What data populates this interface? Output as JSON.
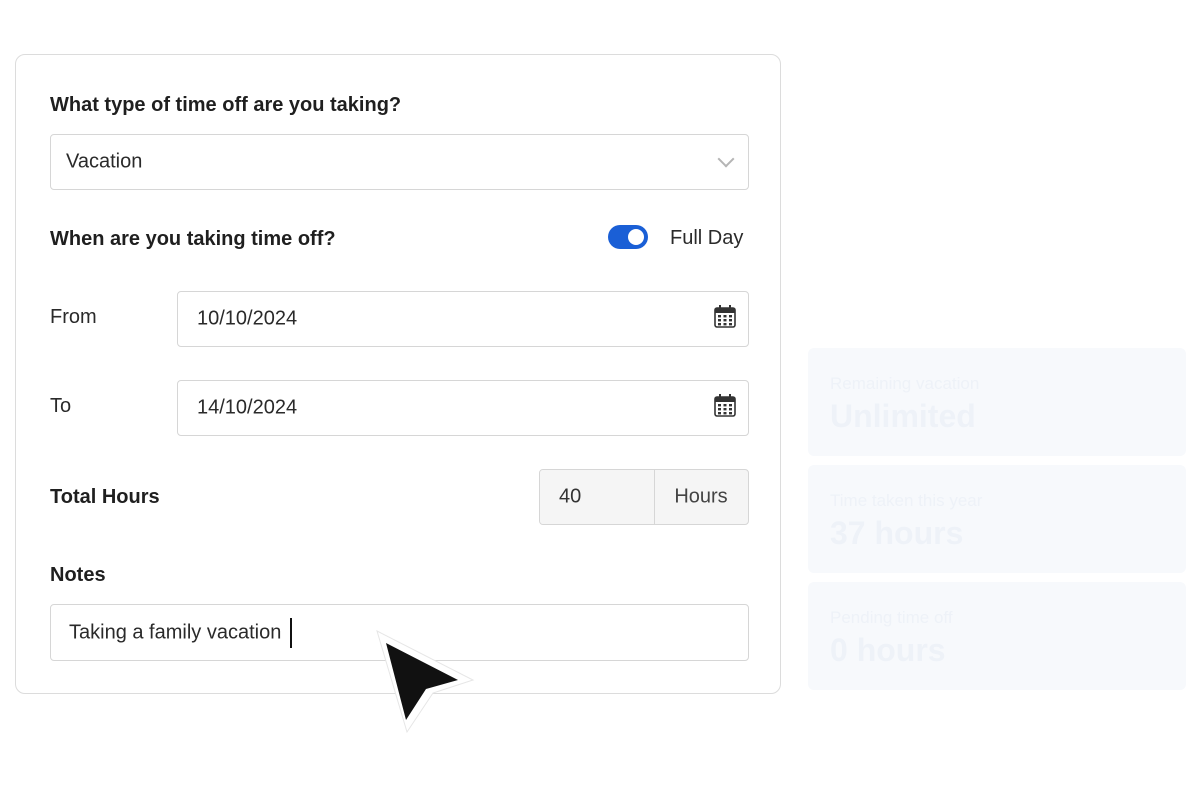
{
  "form": {
    "type_question": "What type of time off are you taking?",
    "type_value": "Vacation",
    "when_question": "When are you taking time off?",
    "full_day_label": "Full Day",
    "full_day_on": true,
    "from_label": "From",
    "from_value": "10/10/2024",
    "to_label": "To",
    "to_value": "14/10/2024",
    "total_hours_label": "Total Hours",
    "total_hours_value": "40",
    "hours_unit": "Hours",
    "notes_label": "Notes",
    "notes_value": "Taking a family vacation"
  },
  "summary_cards": [
    {
      "label": "Remaining vacation",
      "value": "Unlimited"
    },
    {
      "label": "Time taken this year",
      "value": "37 hours"
    },
    {
      "label": "Pending time off",
      "value": "0 hours"
    }
  ],
  "colors": {
    "accent": "#1a5fd6",
    "border": "#d6d6d6"
  },
  "icons": [
    "chevron-down-icon",
    "calendar-icon",
    "mouse-pointer-icon"
  ]
}
